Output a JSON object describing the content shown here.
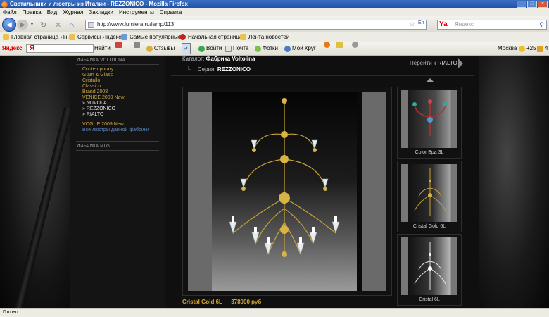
{
  "window": {
    "title": "Светильники и люстры из Италии - REZZONICO - Mozilla Firefox"
  },
  "menu": {
    "items": [
      "Файл",
      "Правка",
      "Вид",
      "Журнал",
      "Закладки",
      "Инструменты",
      "Справка"
    ]
  },
  "nav": {
    "url": "http://www.lumiera.ru/lamp/113",
    "search_placeholder": "Яндекс",
    "search_engine": "Ya",
    "lang": "En"
  },
  "bookmarks": [
    {
      "label": "Главная страница Ян...",
      "icon": "yandex-icon"
    },
    {
      "label": "Сервисы Яндекса",
      "icon": "folder-icon"
    },
    {
      "label": "Самые популярные",
      "icon": "popular-icon"
    },
    {
      "label": "Начальная страница",
      "icon": "heart-icon"
    },
    {
      "label": "Лента новостей",
      "icon": "rss-folder-icon"
    }
  ],
  "yandex_bar": {
    "brand": "Яндекс",
    "find": "Найти",
    "reviews": "Отзывы",
    "login": "Войти",
    "mail": "Почта",
    "photos": "Фотки",
    "my_circle": "Мой Круг",
    "city": "Москва",
    "temp": "+25",
    "traffic": "4"
  },
  "sidebar": {
    "factory1": "ФАБРИКА VOLTOLINA",
    "items": [
      {
        "label": "Contemporary",
        "style": "gold"
      },
      {
        "label": "Glam & Glass",
        "style": "gold"
      },
      {
        "label": "Cristallo",
        "style": "gold"
      },
      {
        "label": "Classico",
        "style": "gold"
      },
      {
        "label": "Brand 2008",
        "style": "gold"
      },
      {
        "label": "VENICE 2009 New",
        "style": "gold"
      },
      {
        "label": "» NUVOLA",
        "style": "white"
      },
      {
        "label": "» REZZONICO",
        "style": "white"
      },
      {
        "label": "» RIALTO",
        "style": "white"
      },
      {
        "label": "VOGUE 2009 New",
        "style": "gold"
      },
      {
        "label": "Все люстры данной фабрики",
        "style": "blue"
      }
    ],
    "factory2": "ФАБРИКА MLG"
  },
  "main": {
    "catalog_label": "Каталог:",
    "catalog_value": "Фабрика Voltolina",
    "series_label": "Серия:",
    "series_value": "REZZONICO",
    "goto_label": "Перейти к",
    "goto_link": "RIALTO",
    "caption": "Cristal Gold 6L — 378000 руб",
    "thumbs": [
      {
        "caption": "Color Бра 3L"
      },
      {
        "caption": "Cristal Gold 6L"
      },
      {
        "caption": "Cristal 6L"
      }
    ]
  },
  "status": {
    "text": "Готово"
  }
}
